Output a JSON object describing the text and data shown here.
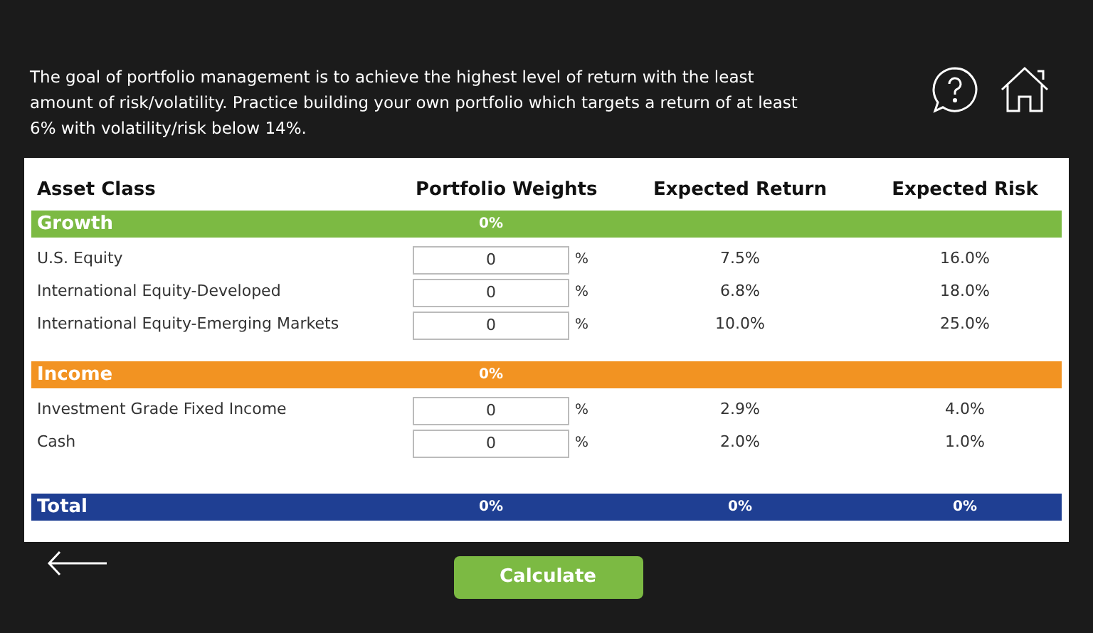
{
  "intro": "The goal of portfolio management is to achieve the highest level of return with the least amount of risk/volatility. Practice building your own portfolio which targets a return of at least 6% with volatility/risk below 14%.",
  "columns": [
    "Asset Class",
    "Portfolio Weights",
    "Expected Return",
    "Expected Risk"
  ],
  "groups": [
    {
      "name": "Growth",
      "color": "#7cba43",
      "weight_total": "0%",
      "assets": [
        {
          "name": "U.S. Equity",
          "weight": "0",
          "unit": "%",
          "return": "7.5%",
          "risk": "16.0%"
        },
        {
          "name": "International Equity-Developed",
          "weight": "0",
          "unit": "%",
          "return": "6.8%",
          "risk": "18.0%"
        },
        {
          "name": "International Equity-Emerging Markets",
          "weight": "0",
          "unit": "%",
          "return": "10.0%",
          "risk": "25.0%"
        }
      ]
    },
    {
      "name": "Income",
      "color": "#f29322",
      "weight_total": "0%",
      "assets": [
        {
          "name": "Investment Grade Fixed Income",
          "weight": "0",
          "unit": "%",
          "return": "2.9%",
          "risk": "4.0%"
        },
        {
          "name": "Cash",
          "weight": "0",
          "unit": "%",
          "return": "2.0%",
          "risk": "1.0%"
        }
      ]
    }
  ],
  "total": {
    "label": "Total",
    "weight": "0%",
    "return": "0%",
    "risk": "0%"
  },
  "calculate_button": "Calculate"
}
